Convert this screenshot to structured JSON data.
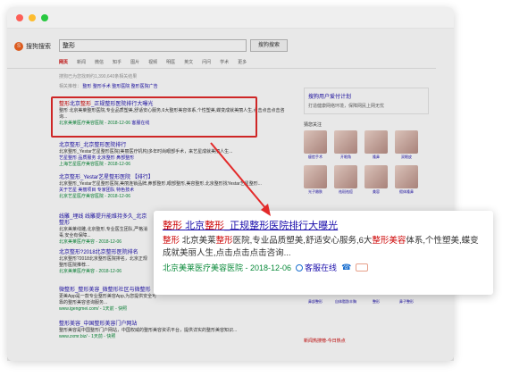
{
  "browser": {
    "dots": [
      "close",
      "minimize",
      "maximize"
    ]
  },
  "header": {
    "logo_text": "搜狗搜索",
    "search_value": "整形",
    "search_button": "搜狗搜索"
  },
  "tabs": [
    "网页",
    "新闻",
    "微信",
    "知乎",
    "图片",
    "视频",
    "明医",
    "英文",
    "问问",
    "学术",
    "更多"
  ],
  "tip": "搜狗已为您找到约1,390,640条相关结果",
  "related": {
    "label": "相关推荐：",
    "items": [
      "整形",
      "整形手术",
      "整形医院",
      "整形医院广告"
    ]
  },
  "results": [
    {
      "title_kw1": "整形",
      "title_mid": "北京",
      "title_kw2": "整形",
      "title_tail": "_正规整形医院排行大曝光",
      "desc": "整形 北京美莱整形医院,专业品质塑美,舒适安心服务,6大整形美容体系,个性塑美,蝶变成就美丽人生,点击点击点击咨询...",
      "url": "北京美莱医疗美容医院 - 2018-12-06",
      "service": "客服在线"
    },
    {
      "title": "北京整形_北京整形医院排行",
      "desc": "北京整形_Yestar艺星整形医院(美丽医疗机构)多年时尚眼部手术，来艺星成就美丽人生...",
      "links": "艺星整形   品质服务   北京整形   鼻部整形",
      "url": "上海艺星医疗美容医院 - 2018-12-06"
    },
    {
      "title": "北京整形_Yestar艺星整形医院 【排行】",
      "desc": "北京整形_Yestar艺星整形医院,美丽连锁品牌,鼻部整形,眼部整形,美容整形,北京整形找Yestar艺星整形...",
      "links": "关于艺星   美丽项目   专家团队   特色技术",
      "url": "北京艺星医疗美容医院 - 2018-12-06"
    },
    {
      "title": "线雕_埋线 线雕提升能维持多久_北京整形",
      "desc": "北京美莱线雕,北京整形,专业医生团队,严格消毒,安全有保障...",
      "url": "北京美莱医疗美容 - 2018-12-06"
    },
    {
      "title": "北京整形?2018北京整形医院排名",
      "desc": "北京整形?2018北京整形医院排名，北京正规整形医院推荐...",
      "url": "北京美莱医疗美容 - 2018-12-06"
    },
    {
      "title": "微整形_整形美容_微整形社区与微整形",
      "desc": "更美App是一款专业整形美容App,为您提供安全可靠的整形美容咨询服务...",
      "url": "www.igengmei.com/ - 1天前 - 快照"
    },
    {
      "title": "整形美容_中国整形美容门户网站",
      "desc": "整形美容是中国整形门户网站，中国权威的整形美容资讯平台，提供详实的整形美容知识...",
      "url": "www.zxmr.biz/ - 1天前 - 快照"
    }
  ],
  "zoom": {
    "title_kw1": "整形",
    "title_mid": "北京",
    "title_kw2": "整形",
    "title_tail": "_正规整形医院排行大曝光",
    "desc_kw1": "整形",
    "desc_part1": " 北京美莱",
    "desc_kw2": "整形",
    "desc_part2": "医院,专业品质塑美,舒适安心服务,6大",
    "desc_kw3": "整形美容",
    "desc_part3": "体系,个性塑美,蝶变成就美丽人生,点击点击点击咨询...",
    "url": "北京美莱医疗美容医院 - 2018-12-06",
    "service": "客服在线"
  },
  "sidebar": {
    "card_title": "搜狗用户爱付计划",
    "card_desc": "打造健康网络环境，保障网民上网无忧",
    "section_title": "猜您关注",
    "thumbs": [
      "瘦脸手术",
      "开眼角",
      "隆鼻",
      "双眼皮",
      "光子嫩肤",
      "祛斑祛痘",
      "美容",
      "假体隆鼻"
    ],
    "thumbs2": [
      "鼻部整形",
      "自体脂肪丰胸",
      "整形",
      "鼻子整形"
    ],
    "hot_title": "新闻热搜榜-今日热点"
  }
}
